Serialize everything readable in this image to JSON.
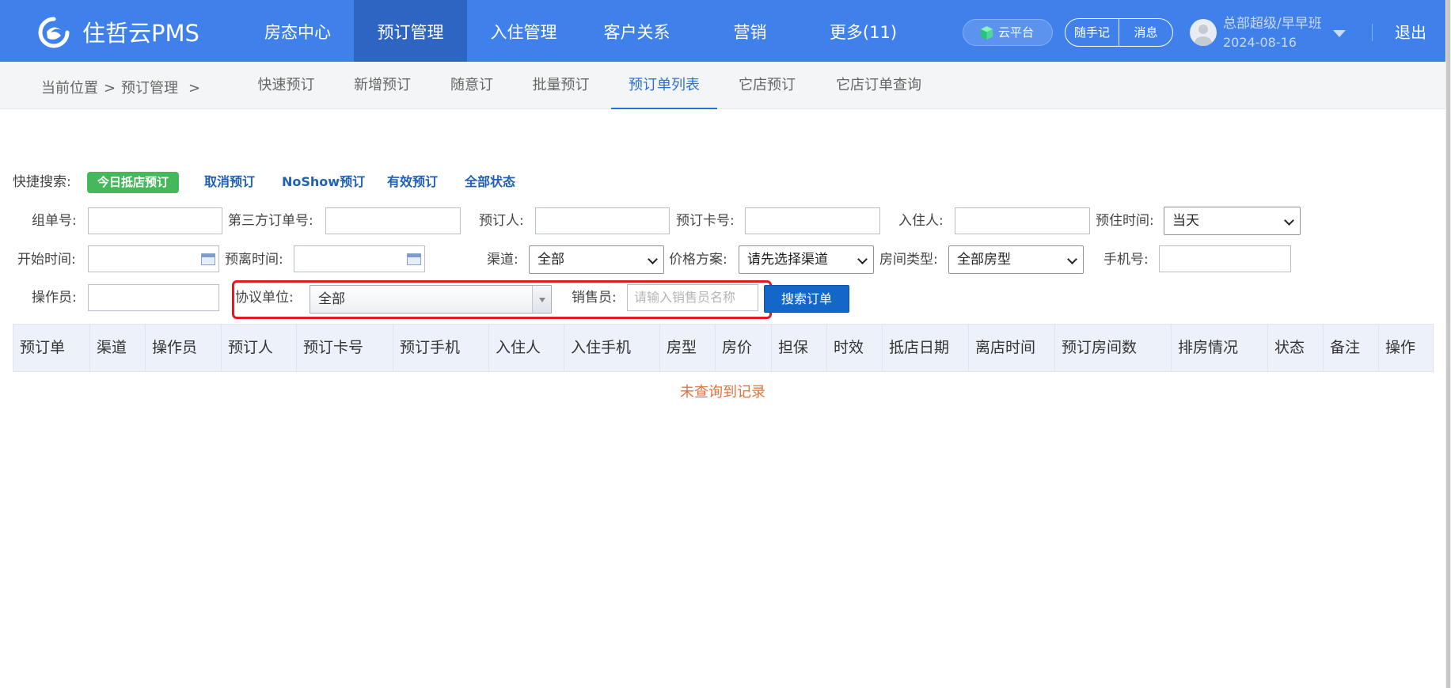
{
  "header": {
    "brand": "住哲云PMS",
    "nav": [
      "房态中心",
      "预订管理",
      "入住管理",
      "客户关系",
      "营销",
      "更多(11)"
    ],
    "active_nav": "预订管理",
    "cloud_platform": "云平台",
    "notes": "随手记",
    "messages": "消息",
    "user_name": "总部超级/早早班",
    "user_date": "2024-08-16",
    "logout": "退出"
  },
  "subnav": {
    "breadcrumb_position": "当前位置",
    "breadcrumb_sep1": ">",
    "breadcrumb_module": "预订管理",
    "breadcrumb_sep2": ">",
    "tabs": [
      "快速预订",
      "新增预订",
      "随意订",
      "批量预订",
      "预订单列表",
      "它店预订",
      "它店订单查询"
    ],
    "active_tab": "预订单列表"
  },
  "quick_search": {
    "label": "快捷搜索:",
    "today_arrival": "今日抵店预订",
    "cancelled": "取消预订",
    "noshow": "NoShow预订",
    "valid": "有效预订",
    "all_status": "全部状态"
  },
  "filters": {
    "group_no_label": "组单号:",
    "group_no_value": "",
    "third_party_label": "第三方订单号:",
    "third_party_value": "",
    "booker_label": "预订人:",
    "booker_value": "",
    "card_label": "预订卡号:",
    "card_value": "",
    "guest_label": "入住人:",
    "guest_value": "",
    "stay_time_label": "预住时间:",
    "stay_time_value": "当天",
    "start_time_label": "开始时间:",
    "start_time_value": "",
    "leave_time_label": "预离时间:",
    "leave_time_value": "",
    "channel_label": "渠道:",
    "channel_value": "全部",
    "price_plan_label": "价格方案:",
    "price_plan_value": "请先选择渠道",
    "room_type_label": "房间类型:",
    "room_type_value": "全部房型",
    "phone_label": "手机号:",
    "phone_value": "",
    "operator_label": "操作员:",
    "operator_value": "",
    "agreement_label": "协议单位:",
    "agreement_value": "全部",
    "sales_label": "销售员:",
    "sales_placeholder": "请输入销售员名称",
    "search_button": "搜索订单"
  },
  "table": {
    "columns": [
      "预订单",
      "渠道",
      "操作员",
      "预订人",
      "预订卡号",
      "预订手机",
      "入住人",
      "入住手机",
      "房型",
      "房价",
      "担保",
      "时效",
      "抵店日期",
      "离店时间",
      "预订房间数",
      "排房情况",
      "状态",
      "备注",
      "操作"
    ],
    "rows": [],
    "empty_message": "未查询到记录"
  },
  "colors": {
    "topbar": "#3f80ea",
    "active_nav": "#2e64c2",
    "quick_green": "#45b85b",
    "link_blue": "#2060b4",
    "search_button": "#1367c9",
    "highlight_red": "#e5191f",
    "empty_text": "#e3703a"
  }
}
